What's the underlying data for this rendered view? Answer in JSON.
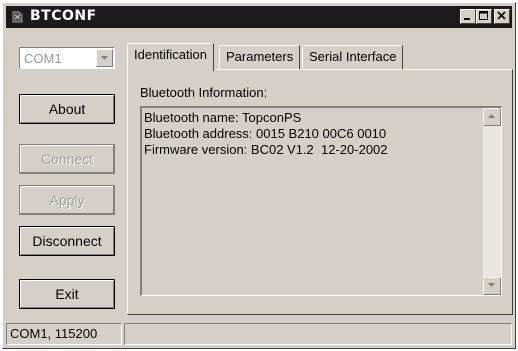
{
  "window": {
    "title": "BTCONF"
  },
  "port_select": {
    "value": "COM1"
  },
  "buttons": {
    "about": "About",
    "connect": "Connect",
    "apply": "Apply",
    "disconnect": "Disconnect",
    "exit": "Exit"
  },
  "tabs": [
    {
      "label": "Identification",
      "active": true
    },
    {
      "label": "Parameters",
      "active": false
    },
    {
      "label": "Serial Interface",
      "active": false
    }
  ],
  "identification": {
    "section_label": "Bluetooth Information:",
    "lines": [
      "Bluetooth name: TopconPS",
      "Bluetooth address: 0015 B210 00C6 0010",
      "Firmware version: BC02 V1.2  12-20-2002"
    ]
  },
  "statusbar": {
    "port_info": "COM1, 115200",
    "message": ""
  },
  "colors": {
    "face": "#d4d0c8",
    "titlebar": "#1b1b1b",
    "disabled_text": "#a0a0a0"
  }
}
